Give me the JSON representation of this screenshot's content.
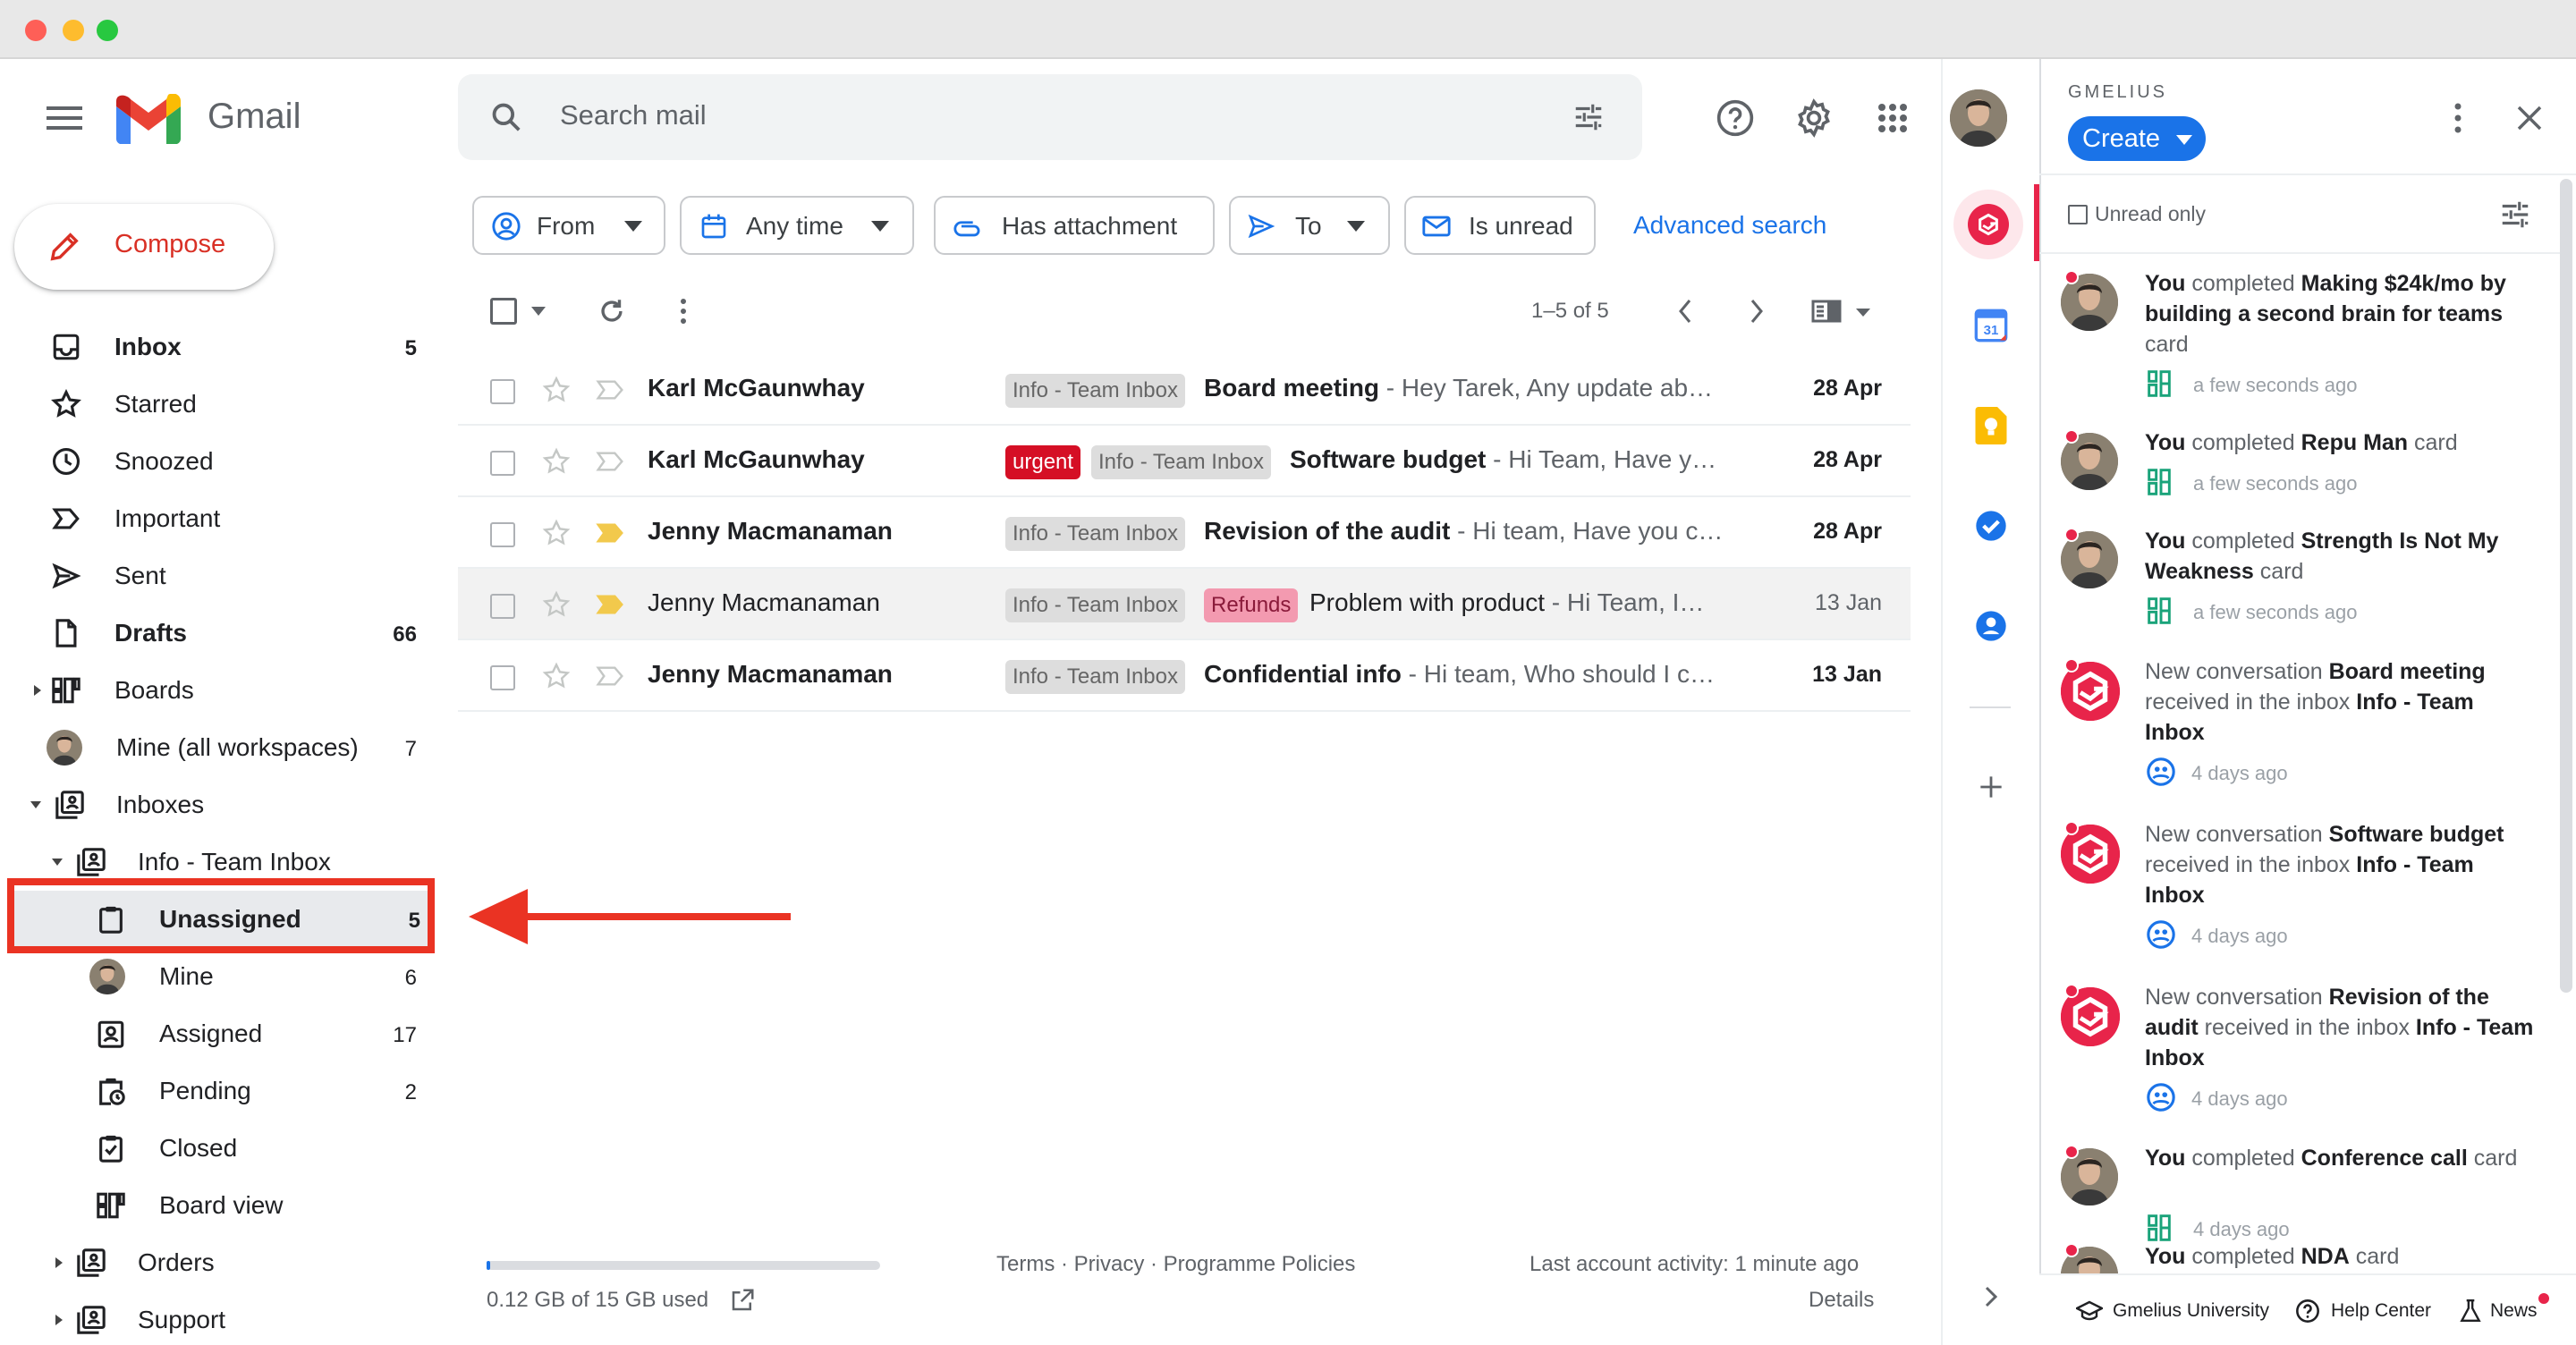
{
  "header": {
    "app_name": "Gmail",
    "search_placeholder": "Search mail"
  },
  "compose": {
    "label": "Compose"
  },
  "nav": [
    {
      "label": "Inbox",
      "count": "5",
      "bold": true
    },
    {
      "label": "Starred",
      "count": ""
    },
    {
      "label": "Snoozed",
      "count": ""
    },
    {
      "label": "Important",
      "count": ""
    },
    {
      "label": "Sent",
      "count": ""
    },
    {
      "label": "Drafts",
      "count": "66",
      "bold": true
    },
    {
      "label": "Boards",
      "count": ""
    },
    {
      "label": "Mine (all workspaces)",
      "count": "7"
    },
    {
      "label": "Inboxes",
      "count": ""
    },
    {
      "label": "Info - Team Inbox",
      "count": ""
    },
    {
      "label": "Unassigned",
      "count": "5",
      "bold": true
    },
    {
      "label": "Mine",
      "count": "6"
    },
    {
      "label": "Assigned",
      "count": "17"
    },
    {
      "label": "Pending",
      "count": "2"
    },
    {
      "label": "Closed",
      "count": ""
    },
    {
      "label": "Board view",
      "count": ""
    },
    {
      "label": "Orders",
      "count": ""
    },
    {
      "label": "Support",
      "count": ""
    }
  ],
  "filters": {
    "from": "From",
    "any_time": "Any time",
    "has_attachment": "Has attachment",
    "to": "To",
    "is_unread": "Is unread",
    "advanced": "Advanced search"
  },
  "toolbar": {
    "pagination": "1–5 of 5"
  },
  "emails": [
    {
      "sender": "Karl McGaunwhay",
      "labels": [
        "Info - Team Inbox"
      ],
      "subject": "Board meeting",
      "snippet": " - Hey Tarek, Any update ab…",
      "date": "28 Apr",
      "unread": true
    },
    {
      "sender": "Karl McGaunwhay",
      "labels": [
        "urgent",
        "Info - Team Inbox"
      ],
      "subject": "Software budget",
      "snippet": " - Hi Team, Have y…",
      "date": "28 Apr",
      "unread": true
    },
    {
      "sender": "Jenny Macmanaman",
      "labels": [
        "Info - Team Inbox"
      ],
      "subject": "Revision of the audit",
      "snippet": " - Hi team, Have you c…",
      "date": "28 Apr",
      "unread": true
    },
    {
      "sender": "Jenny Macmanaman",
      "labels": [
        "Info - Team Inbox",
        "Refunds"
      ],
      "subject": "Problem with product",
      "snippet": " - Hi Team, I…",
      "date": "13 Jan",
      "unread": false
    },
    {
      "sender": "Jenny Macmanaman",
      "labels": [
        "Info - Team Inbox"
      ],
      "subject": "Confidential info",
      "snippet": " - Hi team, Who should I c…",
      "date": "13 Jan",
      "unread": true
    }
  ],
  "footer": {
    "storage": "0.12 GB of 15 GB used",
    "storage_fraction": 0.008,
    "links": "Terms · Privacy · Programme Policies",
    "activity": "Last account activity: 1 minute ago",
    "details": "Details"
  },
  "gmelius": {
    "brand": "GMELIUS",
    "create": "Create",
    "unread_only": "Unread only",
    "feed": [
      {
        "pre": "You",
        "mid": " completed ",
        "bold": "Making $24k/mo by building a second brain for teams",
        "post": " card",
        "time": "a few seconds ago",
        "kind": "card"
      },
      {
        "pre": "You",
        "mid": " completed ",
        "bold": "Repu Man",
        "post": " card",
        "time": "a few seconds ago",
        "kind": "card"
      },
      {
        "pre": "You",
        "mid": " completed ",
        "bold": "Strength Is Not My Weakness",
        "post": " card",
        "time": "a few seconds ago",
        "kind": "card"
      },
      {
        "pre": "",
        "mid": "New conversation ",
        "bold": "Board meeting",
        "post": " received in the inbox ",
        "bold2": "Info - Team Inbox",
        "time": "4 days ago",
        "kind": "conv"
      },
      {
        "pre": "",
        "mid": "New conversation ",
        "bold": "Software budget",
        "post": " received in the inbox ",
        "bold2": "Info - Team Inbox",
        "time": "4 days ago",
        "kind": "conv"
      },
      {
        "pre": "",
        "mid": "New conversation ",
        "bold": "Revision of the audit",
        "post": " received in the inbox ",
        "bold2": "Info - Team Inbox",
        "time": "4 days ago",
        "kind": "conv"
      },
      {
        "pre": "You",
        "mid": " completed ",
        "bold": "Conference call",
        "post": " card",
        "time": "4 days ago",
        "kind": "card"
      },
      {
        "pre": "You",
        "mid": " completed ",
        "bold": "NDA",
        "post": " card",
        "time": "",
        "kind": "card"
      }
    ],
    "footer": {
      "university": "Gmelius University",
      "help": "Help Center",
      "news": "News"
    }
  },
  "colors": {
    "accent_blue": "#1a73e8",
    "gmelius_red": "#e8244a",
    "highlight_red": "#ea3323",
    "urgent": "#d50f25",
    "refunds": "#f39ab0"
  }
}
